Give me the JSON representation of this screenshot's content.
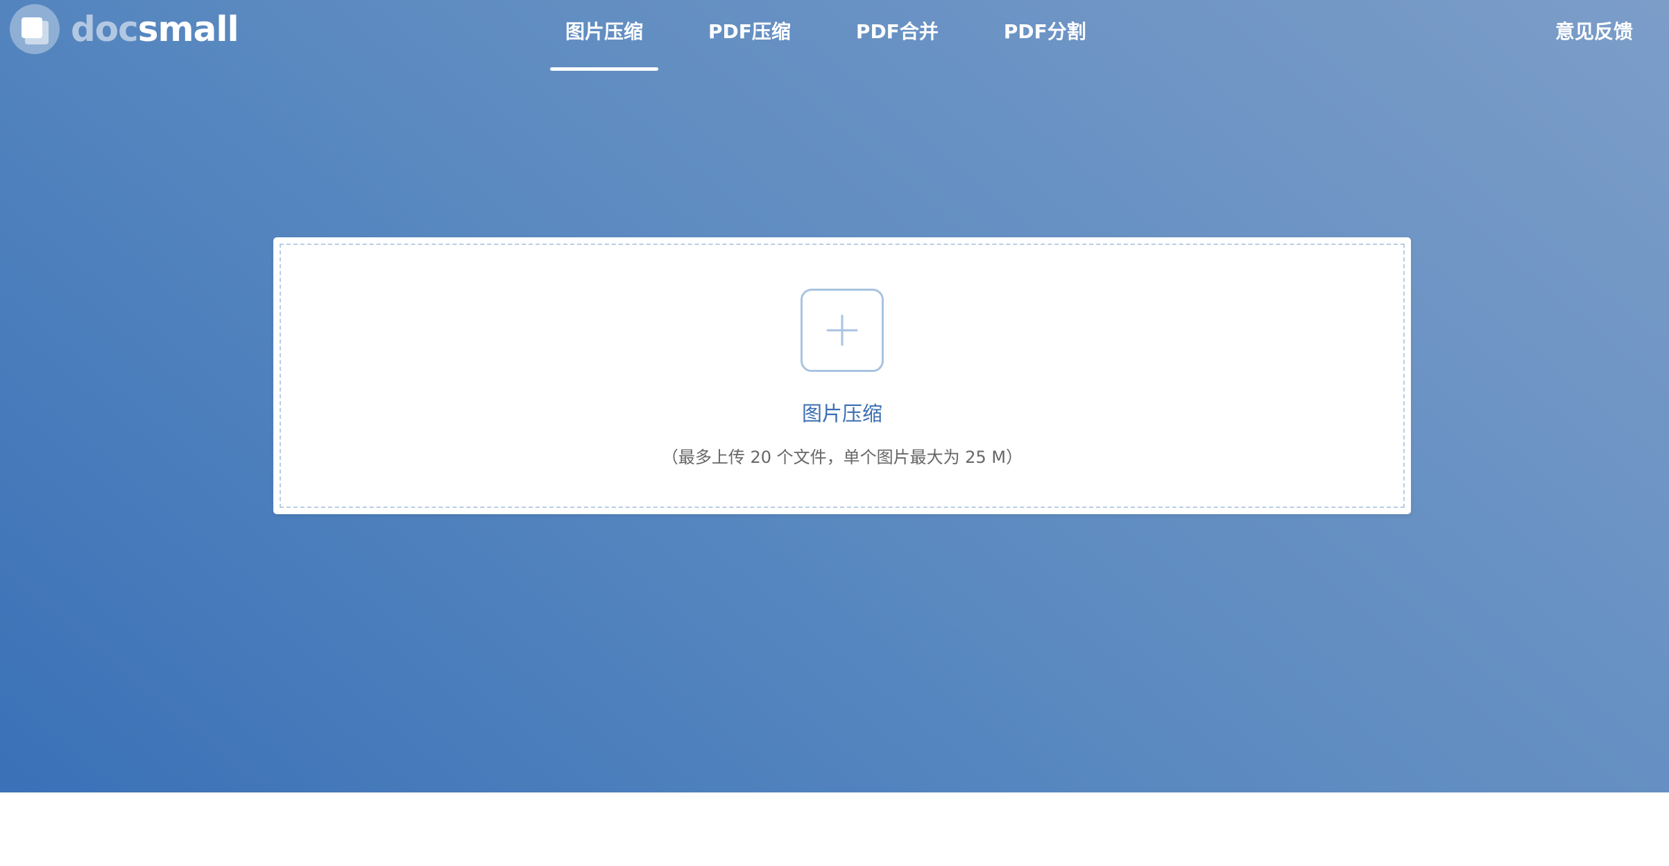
{
  "brand": {
    "name_part1": "doc",
    "name_part2": "small",
    "logo_icon": "layered-squares-icon"
  },
  "nav": {
    "items": [
      {
        "label": "图片压缩",
        "active": true
      },
      {
        "label": "PDF压缩",
        "active": false
      },
      {
        "label": "PDF合并",
        "active": false
      },
      {
        "label": "PDF分割",
        "active": false
      }
    ],
    "feedback_label": "意见反馈"
  },
  "upload": {
    "icon": "plus-icon",
    "title": "图片压缩",
    "hint": "（最多上传 20 个文件，单个图片最大为 25 M）"
  },
  "colors": {
    "hero_gradient_start": "#3a71b7",
    "hero_gradient_end": "#7c9dc8",
    "accent_text": "#3a6db0",
    "dropzone_border": "#b9cde3",
    "hint_text": "#666666"
  }
}
